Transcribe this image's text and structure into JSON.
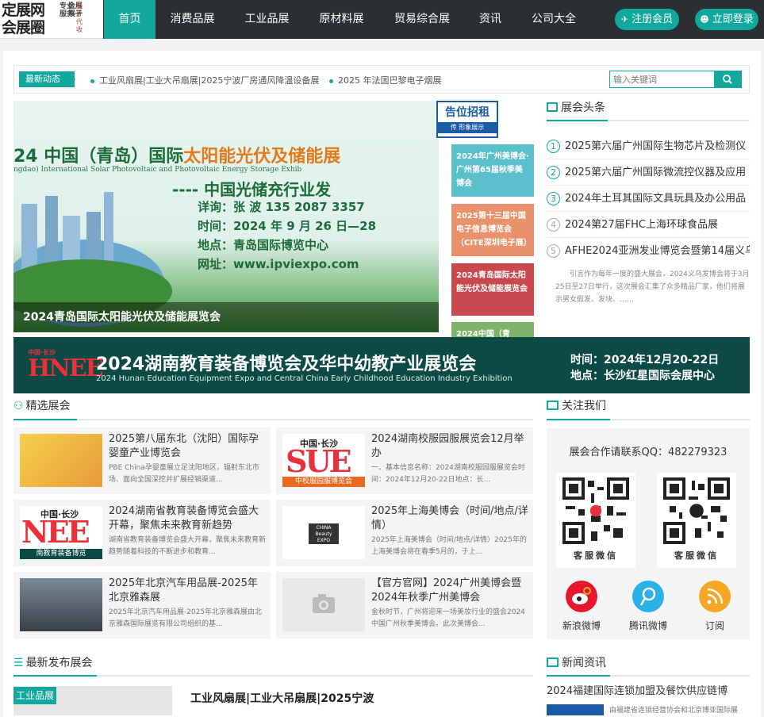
{
  "logo": {
    "main_line1": "定展网",
    "main_line2": "会展圈",
    "tag1": "专业服务",
    "tag2": "会展展子",
    "tag3": "名片代收"
  },
  "nav": {
    "items": [
      "首页",
      "消费品展",
      "工业品展",
      "原材料展",
      "贸易综合展",
      "资讯",
      "公司大全"
    ],
    "register": "注册会员",
    "login": "立即登录"
  },
  "ticker": {
    "label": "最新动态",
    "items": [
      "工业风扇展|工业大吊扇展|2025宁波厂房通风降温设备展",
      "2025 年法国巴黎电子烟展"
    ]
  },
  "search": {
    "placeholder": "输入关键词"
  },
  "hero": {
    "line1_a": "24 中国（青岛）国际",
    "line1_b": "太阳能光伏及储能展",
    "line2": "ngdao) International Solar Photovoltaic and Photovoltaic Energy Storage Exhib",
    "line3": "---- 中国光储充行业发",
    "line4": "详询：张 波  135 2087 3357",
    "line5": "时间：2024 年 9 月 26 日—28",
    "line6": "地点：青岛国际博览中心",
    "line7": "网址：www.ipviexpo.com",
    "caption": "2024青岛国际太阳能光伏及储能展览会"
  },
  "ad": {
    "title": "告位招租",
    "sub": "传  形象展示"
  },
  "side_cards": [
    {
      "text": "2024年广州美博会·广州第65届秋季美博会",
      "color": "#5bc0cc"
    },
    {
      "text": "2025第十三届中国电子信息博览会（CITE深圳电子展）",
      "color": "#e8916a"
    },
    {
      "text": "2024青岛国际太阳能光伏及储能展览会",
      "color": "#c9484e"
    },
    {
      "text": "2024中国（青",
      "color": "#7db36a"
    }
  ],
  "headlines": {
    "title": "展会头条",
    "items": [
      {
        "num": "1",
        "text": "2025第六届广州国际生物芯片及检测仪"
      },
      {
        "num": "2",
        "text": "2025第六届广州国际微流控仪器及应用"
      },
      {
        "num": "3",
        "text": "2024年土耳其国际文具玩具及办公用品"
      },
      {
        "num": "4",
        "text": "2024第27届FHC上海环球食品展"
      },
      {
        "num": "5",
        "text": "AFHE2024亚洲发业博览会暨第14届义乌"
      }
    ],
    "desc": "引言作为每年一度的盛大展会，2024义乌发博会将于3月25日至27日举行，这次展会汇集了众多精品厂家，他们将展示男女假发、发块、……"
  },
  "banner": {
    "title": "2024湖南教育装备博览会及华中幼教产业展览会",
    "subtitle": "2024 Hunan Education Equipment Expo and Central China Early Childhood Education Industry Exhibition",
    "time": "时间：2024年12月20-22日",
    "place": "地点：长沙红星国际会展中心",
    "logo_top": "中国·长沙",
    "logo_main": "HNEE"
  },
  "featured": {
    "title": "精选展会",
    "cards": [
      {
        "title": "2025第八届东北（沈阳）国际孕婴童产业博览会",
        "desc": "PBE China孕婴童展立足沈阳地区，辐射东北市场、面向全国深挖并扩展经销渠道..."
      },
      {
        "title": "2024湖南校服园服展览会12月举办",
        "desc": "一、基本信息名称：2024湖南校服园服展览会时间：2024年12月20-22日地点：长..."
      },
      {
        "title": "2024湖南省教育装备博览会盛大开幕，聚焦未来教育新趋势",
        "desc": "湖南省教育装备博览会盛大开幕，聚焦未来教育新趋势随着科技的不断进步和教育..."
      },
      {
        "title": "2025年上海美博会（时间/地点/详情）",
        "desc": "2025年上海美博会（时间/地点/详情）2025年的上海美博会将在春季5月的，于上..."
      },
      {
        "title": "2025年北京汽车用品展-2025年北京雅森展",
        "desc": "2025年北京汽车用品展-2025年北京雅森展由北京雅森国际展览有限公司组织的基..."
      },
      {
        "title": "【官方官网】2024广州美博会暨2024年秋季广州美博会",
        "desc": "金秋时节，广州将迎来一场美妆行业的盛会2024中国广州秋季美博会。此次美博会..."
      }
    ],
    "thumb_text": {
      "suse_top": "中国·长沙",
      "suse_main": "SUE",
      "suse_sub": "中校服园服博览会",
      "hnee_top": "中国·长沙",
      "hnee_main": "NEE",
      "hnee_sub": "南教育装备博览",
      "beauty": "CHINA Beauty EXPO"
    }
  },
  "follow": {
    "title": "关注我们",
    "qq": "展会合作请联系QQ：482279323",
    "qr_labels": [
      "客服微信",
      "客服微信"
    ],
    "social": [
      "新浪微博",
      "腾讯微博",
      "订阅"
    ]
  },
  "latest": {
    "title": "最新发布展会",
    "tag": "工业品展",
    "first_title": "工业风扇展|工业大吊扇展|2025宁波"
  },
  "news": {
    "title": "新闻资讯",
    "first": "2024福建国际连锁加盟及餐饮供应链博",
    "first_desc": "由福建省连锁经营协会和北京博亚国际展"
  },
  "colors": {
    "accent": "#13a89e",
    "nav_bg": "#2b2f31"
  }
}
